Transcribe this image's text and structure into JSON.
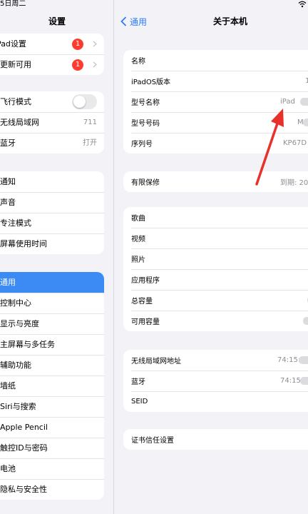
{
  "status_bar": {
    "time": "5日周二"
  },
  "sidebar": {
    "title": "设置",
    "group1": [
      {
        "label": "iPad设置",
        "badge": "1"
      },
      {
        "label": "更新可用",
        "badge": "1"
      }
    ],
    "group2": [
      {
        "label": "飞行模式",
        "toggle": false
      },
      {
        "label": "无线局域网",
        "value": "711"
      },
      {
        "label": "蓝牙",
        "value": "打开"
      }
    ],
    "group3": [
      {
        "label": "通知"
      },
      {
        "label": "声音"
      },
      {
        "label": "专注模式"
      },
      {
        "label": "屏幕使用时间"
      }
    ],
    "group4": [
      {
        "label": "通用",
        "selected": true
      },
      {
        "label": "控制中心"
      },
      {
        "label": "显示与亮度"
      },
      {
        "label": "主屏幕与多任务"
      },
      {
        "label": "辅助功能"
      },
      {
        "label": "墙纸"
      },
      {
        "label": "Siri与搜索"
      },
      {
        "label": "Apple Pencil"
      },
      {
        "label": "触控ID与密码"
      },
      {
        "label": "电池"
      },
      {
        "label": "隐私与安全性"
      }
    ]
  },
  "detail": {
    "back_label": "通用",
    "title": "关于本机",
    "group1": [
      {
        "label": "名称",
        "value": ""
      },
      {
        "label": "iPadOS版本",
        "value": "1"
      },
      {
        "label": "型号名称",
        "value": "iPad"
      },
      {
        "label": "型号号码",
        "value": "M"
      },
      {
        "label": "序列号",
        "value": "KP67D"
      }
    ],
    "group2": [
      {
        "label": "有限保修",
        "value": "到期: 20"
      }
    ],
    "group3": [
      {
        "label": "歌曲",
        "value": ""
      },
      {
        "label": "视频",
        "value": ""
      },
      {
        "label": "照片",
        "value": ""
      },
      {
        "label": "应用程序",
        "value": ""
      },
      {
        "label": "总容量",
        "value": ""
      },
      {
        "label": "可用容量",
        "value": ""
      }
    ],
    "group4": [
      {
        "label": "无线局域网地址",
        "value": "74:15:"
      },
      {
        "label": "蓝牙",
        "value": "74:15:"
      },
      {
        "label": "SEID",
        "value": ""
      }
    ],
    "group5": [
      {
        "label": "证书信任设置"
      }
    ]
  },
  "colors": {
    "accent": "#2f7cf6",
    "selected": "#3c8bf5",
    "badge": "#ff3b30",
    "arrow": "#e8312a"
  }
}
